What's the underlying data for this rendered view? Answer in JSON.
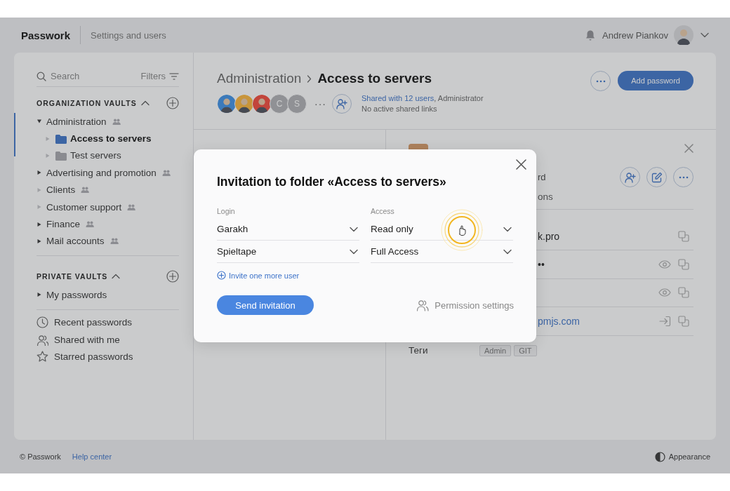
{
  "topbar": {
    "logo": "Passwork",
    "section": "Settings and users",
    "user_name": "Andrew Piankov"
  },
  "sidebar": {
    "search": {
      "placeholder": "Search"
    },
    "filters": "Filters",
    "vault_sections": [
      {
        "title": "ORGANIZATION VAULTS",
        "expanded": true,
        "items": [
          {
            "label": "Administration",
            "shared": true,
            "expandable": true,
            "expanded": true,
            "selected": false,
            "children": [
              {
                "label": "Access to servers",
                "kind": "folder",
                "shared": false,
                "expandable": false,
                "expanded": false,
                "selected": true
              },
              {
                "label": "Test servers",
                "kind": "folder",
                "shared": false,
                "expandable": false,
                "expanded": false,
                "selected": false
              }
            ]
          },
          {
            "label": "Advertising and promotion",
            "shared": true,
            "expandable": true,
            "expanded": false,
            "selected": false
          },
          {
            "label": "Clients",
            "shared": true,
            "expandable": false,
            "expanded": false,
            "selected": false
          },
          {
            "label": "Customer support",
            "shared": true,
            "expandable": false,
            "expanded": false,
            "selected": false
          },
          {
            "label": "Finance",
            "shared": true,
            "expandable": true,
            "expanded": false,
            "selected": false
          },
          {
            "label": "Mail accounts",
            "shared": true,
            "expandable": true,
            "expanded": false,
            "selected": false
          }
        ]
      },
      {
        "title": "PRIVATE VAULTS",
        "expanded": true,
        "items": [
          {
            "label": "My passwords",
            "shared": false,
            "expandable": true,
            "expanded": false,
            "selected": false
          }
        ]
      }
    ],
    "links": [
      {
        "label": "Recent passwords",
        "kind": "recent"
      },
      {
        "label": "Shared with me",
        "kind": "shared"
      },
      {
        "label": "Starred passwords",
        "kind": "starred"
      }
    ]
  },
  "folder_header": {
    "breadcrumb": "Administration",
    "title": "Access to servers",
    "members": [
      {
        "kind": "photo",
        "color": "#3d7ab8"
      },
      {
        "kind": "photo",
        "color": "#c8953a"
      },
      {
        "kind": "photo",
        "color": "#c2453a"
      },
      {
        "kind": "initial",
        "initial": "C"
      },
      {
        "kind": "initial",
        "initial": "S"
      }
    ],
    "more_members": "···",
    "shared_link": "Shared with 12 users",
    "role": ", Administrator",
    "links_note": "No active shared links",
    "add_button": "Add password"
  },
  "detail": {
    "subtitle": "rd",
    "section": "ons",
    "fields": [
      {
        "kind": "text",
        "value": "k.pro"
      },
      {
        "kind": "secret",
        "value": "••"
      },
      {
        "kind": "secret"
      },
      {
        "kind": "url",
        "value": "pmjs.com"
      }
    ],
    "tags_label": "Теги",
    "tags": [
      "Admin",
      "GIT"
    ]
  },
  "modal": {
    "title": "Invitation to folder «Access to servers»",
    "login_label": "Login",
    "access_label": "Access",
    "invites": [
      {
        "login": "Garakh",
        "access": "Read only",
        "clicked": true
      },
      {
        "login": "Spieltape",
        "access": "Full Access",
        "clicked": false
      }
    ],
    "add_link": "Invite one more user",
    "send_button": "Send invitation",
    "permissions_link": "Permission settings"
  },
  "footer": {
    "copyright": "© Passwork",
    "help": "Help center",
    "appearance": "Appearance"
  }
}
